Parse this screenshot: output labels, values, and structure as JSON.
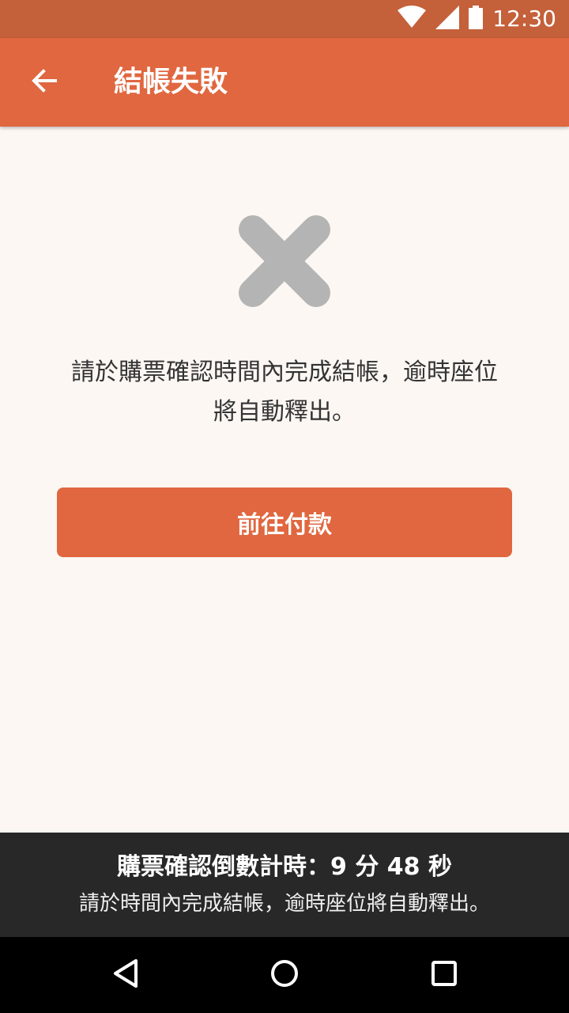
{
  "status_bar": {
    "time": "12:30",
    "icons": [
      "wifi-icon",
      "signal-icon",
      "battery-icon"
    ]
  },
  "app_bar": {
    "back_icon": "arrow-left-icon",
    "title": "結帳失敗"
  },
  "main": {
    "status_icon": "close-x-icon",
    "message_line1": "請於購票確認時間內完成結帳，逾時座位",
    "message_line2": "將自動釋出。",
    "pay_button_label": "前往付款"
  },
  "timer": {
    "title": "購票確認倒數計時：9 分 48 秒",
    "subtitle": "請於時間內完成結帳，逾時座位將自動釋出。"
  },
  "nav_bar": {
    "buttons": [
      "back-triangle-icon",
      "home-circle-icon",
      "recents-square-icon"
    ]
  },
  "colors": {
    "status_bar": "#c4603a",
    "accent": "#e0673f",
    "background": "#fcf7f3",
    "icon_gray": "#b3b4b3",
    "timer_bg": "#272827"
  }
}
